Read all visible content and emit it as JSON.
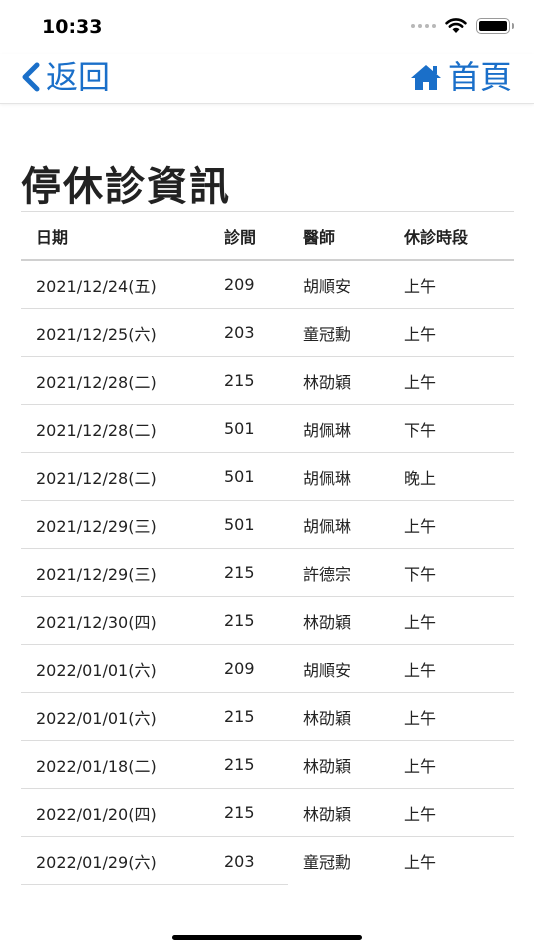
{
  "status_bar": {
    "time": "10:33"
  },
  "nav": {
    "back_label": "返回",
    "home_label": "首頁"
  },
  "page": {
    "title": "停休診資訊"
  },
  "table": {
    "headers": {
      "date": "日期",
      "room": "診間",
      "doctor": "醫師",
      "period": "休診時段"
    },
    "rows": [
      {
        "date": "2021/12/24(五)",
        "room": "209",
        "doctor": "胡順安",
        "period": "上午"
      },
      {
        "date": "2021/12/25(六)",
        "room": "203",
        "doctor": "童冠勳",
        "period": "上午"
      },
      {
        "date": "2021/12/28(二)",
        "room": "215",
        "doctor": "林劭穎",
        "period": "上午"
      },
      {
        "date": "2021/12/28(二)",
        "room": "501",
        "doctor": "胡佩琳",
        "period": "下午"
      },
      {
        "date": "2021/12/28(二)",
        "room": "501",
        "doctor": "胡佩琳",
        "period": "晚上"
      },
      {
        "date": "2021/12/29(三)",
        "room": "501",
        "doctor": "胡佩琳",
        "period": "上午"
      },
      {
        "date": "2021/12/29(三)",
        "room": "215",
        "doctor": "許德宗",
        "period": "下午"
      },
      {
        "date": "2021/12/30(四)",
        "room": "215",
        "doctor": "林劭穎",
        "period": "上午"
      },
      {
        "date": "2022/01/01(六)",
        "room": "209",
        "doctor": "胡順安",
        "period": "上午"
      },
      {
        "date": "2022/01/01(六)",
        "room": "215",
        "doctor": "林劭穎",
        "period": "上午"
      },
      {
        "date": "2022/01/18(二)",
        "room": "215",
        "doctor": "林劭穎",
        "period": "上午"
      },
      {
        "date": "2022/01/20(四)",
        "room": "215",
        "doctor": "林劭穎",
        "period": "上午"
      },
      {
        "date": "2022/01/29(六)",
        "room": "203",
        "doctor": "童冠勳",
        "period": "上午"
      }
    ]
  },
  "colors": {
    "accent": "#1a6fc9",
    "text": "#222222",
    "divider": "#dcdcdc"
  },
  "icons": {
    "back": "chevron-left-icon",
    "home": "home-icon",
    "signal": "signal-dots-icon",
    "wifi": "wifi-icon",
    "battery": "battery-icon"
  }
}
